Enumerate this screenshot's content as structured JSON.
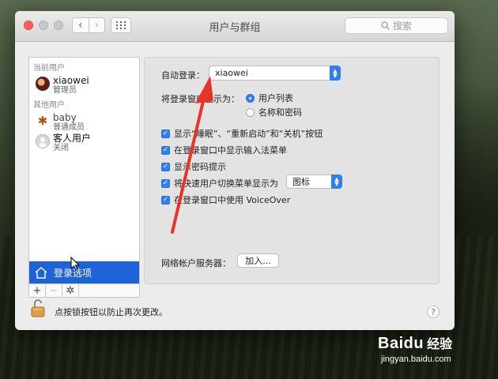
{
  "window": {
    "title": "用户与群组"
  },
  "search": {
    "placeholder": "搜索"
  },
  "sidebar": {
    "current_header": "当前用户",
    "other_header": "其他用户",
    "current_user": {
      "name": "xiaowei",
      "role": "管理员"
    },
    "other_users": [
      {
        "name": "baby",
        "role": "普通成员"
      },
      {
        "name": "客人用户",
        "role": "关闭"
      }
    ],
    "login_options_label": "登录选项",
    "tools": {
      "add": "+",
      "remove": "−"
    }
  },
  "login": {
    "auto_login_label": "自动登录：",
    "auto_login_value": "xiaowei",
    "display_as_label": "将登录窗口显示为：",
    "radio_list": "用户列表",
    "radio_name_pw": "名称和密码",
    "display_as_selected": "用户列表",
    "checkboxes": [
      {
        "label": "显示“睡眠”、“重新启动”和“关机”按钮",
        "checked": true
      },
      {
        "label": "在登录窗口中显示输入法菜单",
        "checked": true
      },
      {
        "label": "显示密码提示",
        "checked": true
      },
      {
        "label": "将快速用户切换菜单显示为",
        "checked": true
      },
      {
        "label": "在登录窗口中使用 VoiceOver",
        "checked": true
      }
    ],
    "fast_switch_value": "图标",
    "network_label": "网络帐户服务器：",
    "join_button": "加入..."
  },
  "footer": {
    "lock_text": "点按锁按钮以防止再次更改。",
    "help": "?"
  },
  "watermark": {
    "brand": "Baidu",
    "cn": "经验",
    "url": "jingyan.baidu.com"
  },
  "colors": {
    "accent": "#2f7ef3",
    "selection": "#1f63d9",
    "annotation_arrow": "#e8332a"
  }
}
